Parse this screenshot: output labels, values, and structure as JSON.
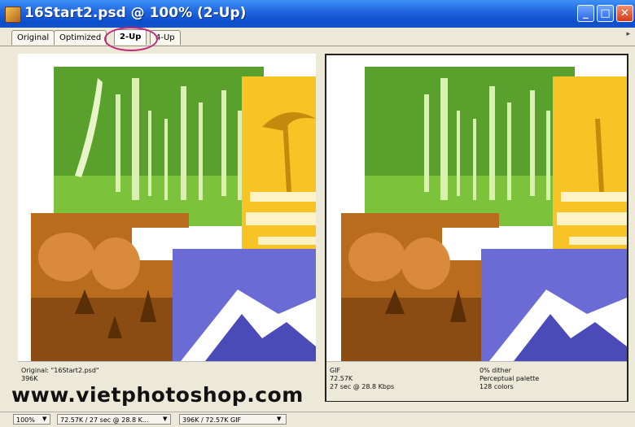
{
  "window": {
    "title": "16Start2.psd @ 100% (2-Up)",
    "buttons": {
      "minimize": "_",
      "maximize": "□",
      "close": "✕"
    }
  },
  "tabs": [
    {
      "label": "Original",
      "active": false
    },
    {
      "label": "Optimized",
      "active": false
    },
    {
      "label": "2-Up",
      "active": true
    },
    {
      "label": "4-Up",
      "active": false
    }
  ],
  "left_panel": {
    "line1": "Original: \"16Start2.psd\"",
    "line2": "396K"
  },
  "right_panel": {
    "format": "GIF",
    "size": "72.57K",
    "timing": "27 sec @ 28.8 Kbps",
    "dither": "0% dither",
    "palette": "Perceptual palette",
    "colors": "128 colors"
  },
  "watermark": "www.vietphotoshop.com",
  "status_bar": {
    "zoom": "100%",
    "download_info": "72.57K / 27 sec @ 28.8 K...",
    "size_info": "396K / 72.57K GIF"
  },
  "colors": {
    "title_bar": "#1f63de",
    "highlight_ring": "#c2297b",
    "forest_green": "#5aa02c",
    "desert_yellow": "#f7c325",
    "canyon_brown": "#b86c1c",
    "mountain_blue": "#6b6bd6"
  }
}
